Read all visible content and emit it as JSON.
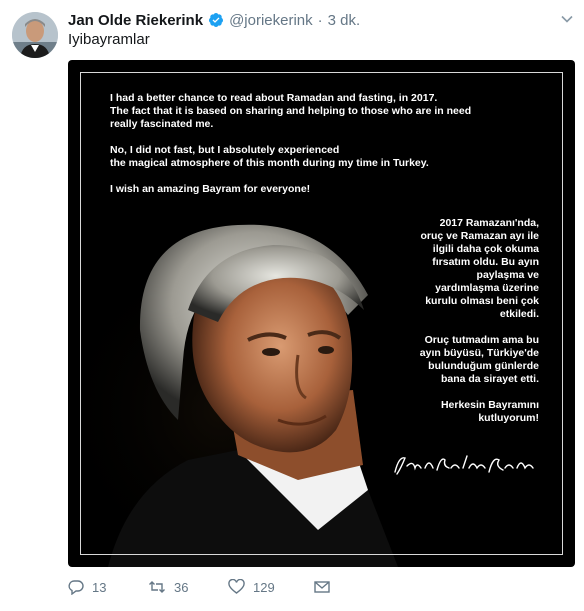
{
  "tweet": {
    "display_name": "Jan Olde Riekerink",
    "handle": "@joriekerink",
    "separator": "·",
    "time": "3 dk.",
    "text": "Iyibayramlar",
    "verified_icon": "verified-badge-icon",
    "menu_icon": "chevron-down-icon"
  },
  "media": {
    "english_paragraphs": [
      "I had a better chance to read about Ramadan and fasting, in 2017.\nThe fact that it is based on sharing and helping to those who are in need\nreally fascinated me.",
      "No, I did not fast, but I absolutely experienced\nthe magical atmosphere of this month during my time in Turkey.",
      "I wish an amazing Bayram for everyone!"
    ],
    "turkish_paragraphs": [
      "2017 Ramazanı'nda,\noruç ve Ramazan ayı ile\nilgili daha çok okuma\nfırsatım oldu. Bu ayın\npaylaşma ve\nyardımlaşma üzerine\nkurulu olması beni çok\netkiledi.",
      "Oruç tutmadım ama bu\nayın büyüsü, Türkiye'de\nbulunduğum günlerde\nbana da sirayet etti.",
      "Herkesin Bayramını\nkutluyorum!"
    ],
    "signature": "Jan Olde Riekerink"
  },
  "actions": {
    "reply_count": "13",
    "retweet_count": "36",
    "like_count": "129"
  },
  "colors": {
    "secondary_text": "#657786",
    "verified_blue": "#1da1f2",
    "media_background": "#000000"
  }
}
